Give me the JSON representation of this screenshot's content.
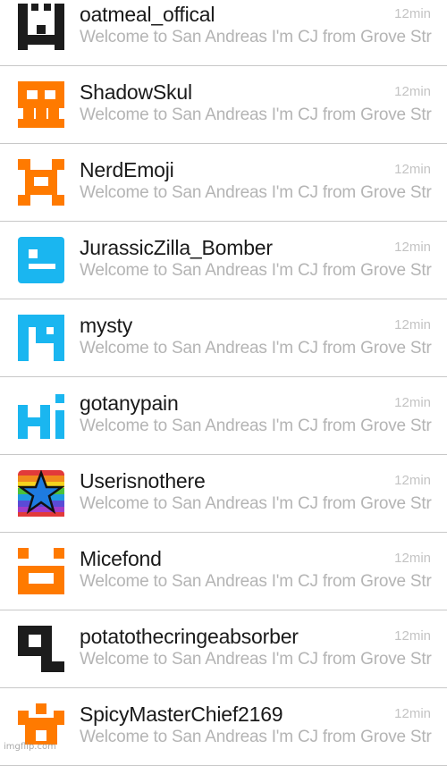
{
  "conversations": [
    {
      "username": "oatmeal_offical",
      "preview": "Welcome to San Andreas I'm CJ from Grove Street",
      "time": "12min",
      "avatar": "black-smile-face-icon",
      "color": "#1c1c1c"
    },
    {
      "username": "ShadowSkul",
      "preview": "Welcome to San Andreas I'm CJ from Grove Street",
      "time": "12min",
      "avatar": "orange-skull-icon",
      "color": "#ff7a00"
    },
    {
      "username": "NerdEmoji",
      "preview": "Welcome to San Andreas I'm CJ from Grove Street",
      "time": "12min",
      "avatar": "orange-invader-icon",
      "color": "#ff7a00"
    },
    {
      "username": "JurassicZilla_Bomber",
      "preview": "Welcome to San Andreas I'm CJ from Grove Street",
      "time": "12min",
      "avatar": "blue-robot-face-icon",
      "color": "#1ab6f0"
    },
    {
      "username": "mysty",
      "preview": "Welcome to San Andreas I'm CJ from Grove Street",
      "time": "12min",
      "avatar": "blue-m-block-icon",
      "color": "#1ab6f0"
    },
    {
      "username": "gotanypain",
      "preview": "Welcome to San Andreas I'm CJ from Grove Street",
      "time": "12min",
      "avatar": "blue-hi-icon",
      "color": "#1ab6f0"
    },
    {
      "username": "Userisnothere",
      "preview": "Welcome to San Andreas I'm CJ from Grove Street",
      "time": "12min",
      "avatar": "rainbow-star-icon",
      "color": "#1e7be0"
    },
    {
      "username": "Micefond",
      "preview": "Welcome to San Andreas I'm CJ from Grove Street",
      "time": "12min",
      "avatar": "orange-grin-face-icon",
      "color": "#ff7a00"
    },
    {
      "username": "potatothecringeabsorber",
      "preview": "Welcome to San Andreas I'm CJ from Grove Street",
      "time": "12min",
      "avatar": "black-q-shape-icon",
      "color": "#1c1c1c"
    },
    {
      "username": "SpicyMasterChief2169",
      "preview": "Welcome to San Andreas I'm CJ from Grove Street",
      "time": "12min",
      "avatar": "orange-figure-icon",
      "color": "#ff7a00"
    }
  ],
  "watermark": "imgflip.com"
}
